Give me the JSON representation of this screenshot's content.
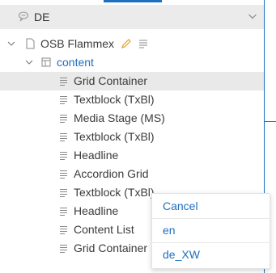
{
  "language_selector": {
    "value": "DE"
  },
  "tree": {
    "root": {
      "label": "OSB Flammex"
    },
    "folder": {
      "label": "content"
    },
    "children": [
      {
        "label": "Grid Container",
        "selected": true
      },
      {
        "label": "Textblock (TxBl)"
      },
      {
        "label": "Media Stage (MS)"
      },
      {
        "label": "Textblock (TxBl)"
      },
      {
        "label": "Headline"
      },
      {
        "label": "Accordion Grid"
      },
      {
        "label": "Textblock (TxBl)"
      },
      {
        "label": "Headline"
      },
      {
        "label": "Content List"
      },
      {
        "label": "Grid Container"
      }
    ]
  },
  "context_menu": {
    "items": [
      {
        "label": "Cancel"
      },
      {
        "label": "en"
      },
      {
        "label": "de_XW"
      }
    ]
  },
  "colors": {
    "accent": "#1f6fbf",
    "selected_row": "#e9e9e9",
    "edit_icon": "#e0a030"
  }
}
